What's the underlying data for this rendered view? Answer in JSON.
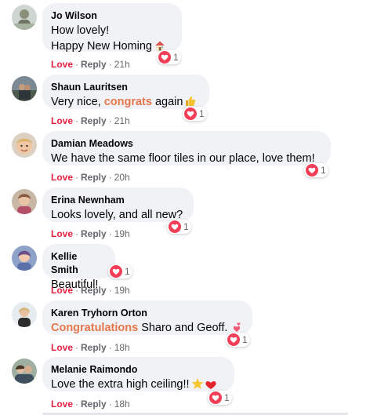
{
  "actions": {
    "love": "Love",
    "reply": "Reply",
    "separator": "·"
  },
  "comments": [
    {
      "author": "Jo Wilson",
      "lines": [
        "How lovely!",
        "Happy New Homing"
      ],
      "emoji": "house-icon",
      "reactions": "1",
      "time": "21h"
    },
    {
      "author": "Shaun Lauritsen",
      "text_before": "Very nice, ",
      "highlight": "congrats",
      "text_after": " again",
      "emoji": "thumbs-up-icon",
      "reactions": "1",
      "time": "21h"
    },
    {
      "author": "Damian Meadows",
      "text": "We have the same floor tiles in our place, love them!",
      "reactions": "1",
      "time": "20h"
    },
    {
      "author": "Erina Newnham",
      "text": "Looks lovely, and all new?",
      "reactions": "1",
      "time": "19h"
    },
    {
      "author": "Kellie Smith",
      "text": "Beautiful!",
      "reactions": "1",
      "time": "19h"
    },
    {
      "author": "Karen Tryhorn Orton",
      "highlight": "Congratulations",
      "text_after": " Sharo and Geoff.",
      "emoji": "two-hearts-icon",
      "reactions": "1",
      "time": "18h"
    },
    {
      "author": "Melanie Raimondo",
      "text": "Love the extra high ceiling!!",
      "emoji": "star-heart-icon",
      "reactions": "1",
      "time": "18h"
    }
  ],
  "colors": {
    "love": "#e41e3f",
    "highlight": "#e5774c",
    "bubble": "#f0f2f5",
    "meta": "#65676b"
  }
}
